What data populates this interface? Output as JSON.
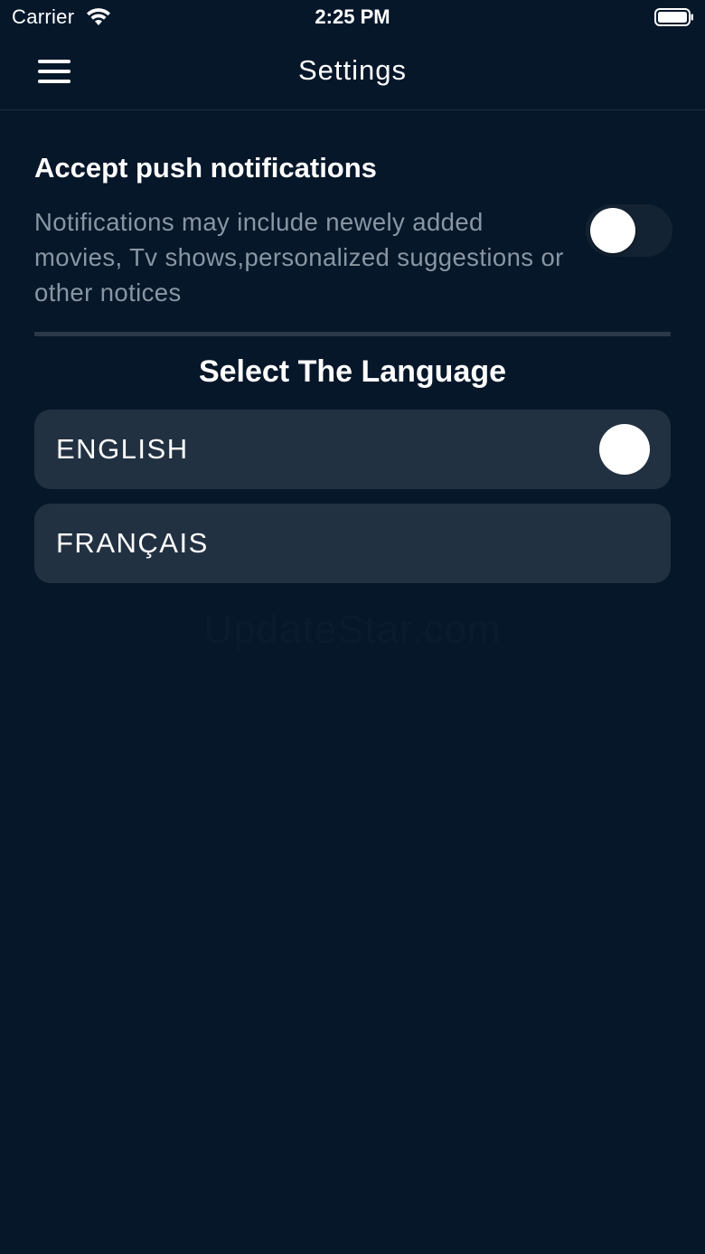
{
  "status_bar": {
    "carrier": "Carrier",
    "time": "2:25 PM"
  },
  "nav": {
    "title": "Settings",
    "menu_icon": "hamburger-menu-icon"
  },
  "notifications": {
    "title": "Accept push notifications",
    "description": "Notifications may include newely added movies, Tv shows,personalized suggestions or other notices",
    "enabled": false
  },
  "language": {
    "title": "Select The Language",
    "options": [
      {
        "label": "ENGLISH",
        "selected": true
      },
      {
        "label": "FRANÇAIS",
        "selected": false
      }
    ]
  },
  "watermark": "UpdateStar.com",
  "colors": {
    "background": "#06172a",
    "card": "#223142",
    "secondary_text": "#8996a3"
  }
}
